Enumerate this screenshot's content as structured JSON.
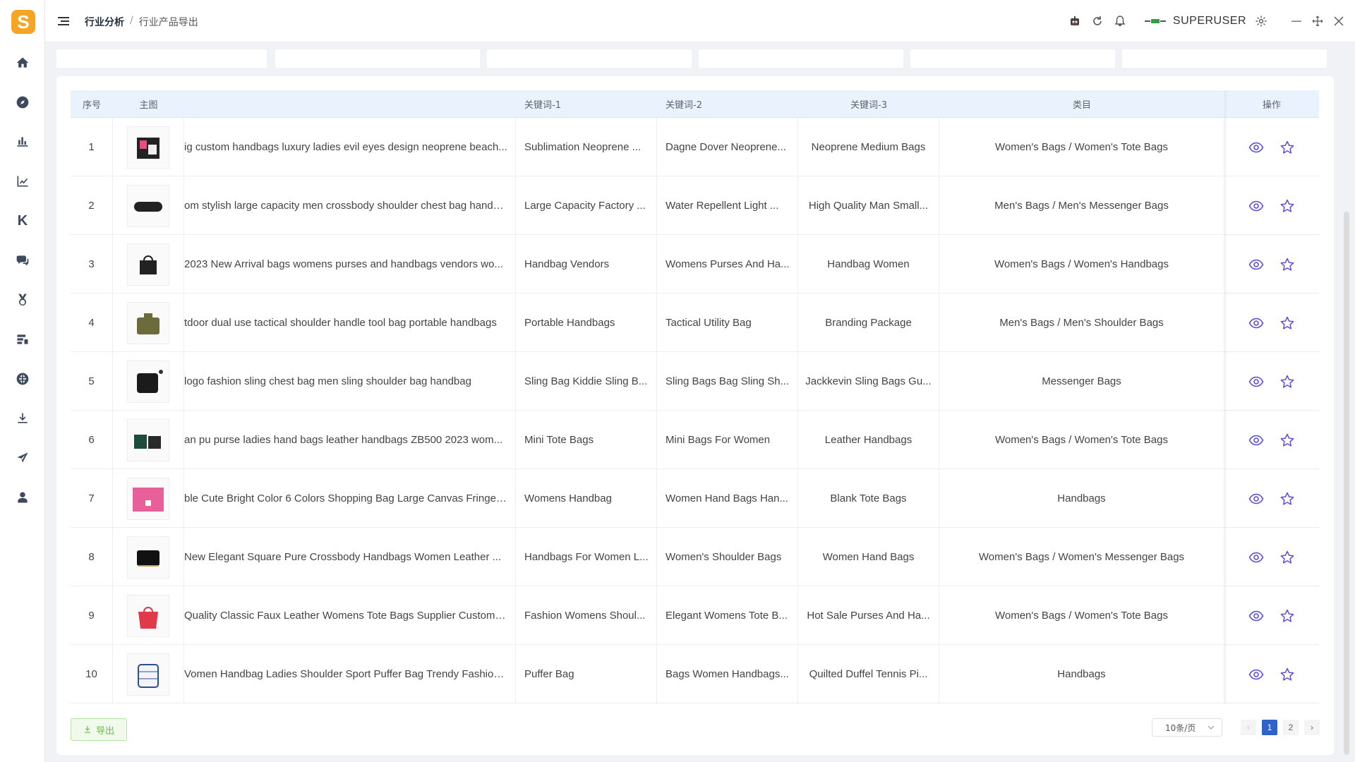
{
  "app": {
    "logo_letter": "S"
  },
  "breadcrumb": {
    "root": "行业分析",
    "separator": "/",
    "current": "行业产品导出"
  },
  "user": {
    "name": "SUPERUSER"
  },
  "sidebar": {
    "icons": [
      "home-icon",
      "compass-icon",
      "analysis-icon",
      "trend-chart-icon",
      "k-icon",
      "chat-icon",
      "medal-icon",
      "product-icon",
      "globe-icon",
      "download-icon",
      "send-icon",
      "user-icon"
    ],
    "k_label": "K"
  },
  "table": {
    "headers": {
      "idx": "序号",
      "img": "主图",
      "title": "",
      "k1": "关键词-1",
      "k2": "关键词-2",
      "k3": "关键词-3",
      "cat": "类目",
      "act": "操作"
    },
    "rows": [
      {
        "idx": "1",
        "title": "ig custom handbags luxury ladies evil eyes design neoprene beach...",
        "k1": "Sublimation Neoprene ...",
        "k2": "Dagne Dover Neoprene...",
        "k3": "Neoprene Medium Bags",
        "cat": "Women's Bags / Women's Tote Bags"
      },
      {
        "idx": "2",
        "title": "om stylish large capacity men crossbody shoulder chest bag handb...",
        "k1": "Large Capacity Factory ...",
        "k2": "Water Repellent Light ...",
        "k3": "High Quality Man Small...",
        "cat": "Men's Bags / Men's Messenger Bags"
      },
      {
        "idx": "3",
        "title": "2023 New Arrival bags womens purses and handbags vendors wo...",
        "k1": "Handbag Vendors",
        "k2": "Womens Purses And Ha...",
        "k3": "Handbag Women",
        "cat": "Women's Bags / Women's Handbags"
      },
      {
        "idx": "4",
        "title": "tdoor dual use tactical shoulder handle tool bag portable handbags",
        "k1": "Portable Handbags",
        "k2": "Tactical Utility Bag",
        "k3": "Branding Package",
        "cat": "Men's Bags / Men's Shoulder Bags"
      },
      {
        "idx": "5",
        "title": "logo fashion sling chest bag men sling shoulder bag handbag",
        "k1": "Sling Bag Kiddie Sling B...",
        "k2": "Sling Bags Bag Sling Sh...",
        "k3": "Jackkevin Sling Bags Gu...",
        "cat": "Messenger Bags"
      },
      {
        "idx": "6",
        "title": "an pu purse ladies hand bags leather handbags ZB500 2023 wom...",
        "k1": "Mini Tote Bags",
        "k2": "Mini Bags For Women",
        "k3": "Leather Handbags",
        "cat": "Women's Bags / Women's Tote Bags"
      },
      {
        "idx": "7",
        "title": "ble Cute Bright Color 6 Colors Shopping Bag Large Canvas Fringe ...",
        "k1": "Womens Handbag",
        "k2": "Women Hand Bags Han...",
        "k3": "Blank Tote Bags",
        "cat": "Handbags"
      },
      {
        "idx": "8",
        "title": "New Elegant Square Pure Crossbody Handbags Women Leather ...",
        "k1": "Handbags For Women L...",
        "k2": "Women's Shoulder Bags",
        "k3": "Women Hand Bags",
        "cat": "Women's Bags / Women's Messenger Bags"
      },
      {
        "idx": "9",
        "title": "Quality Classic Faux Leather Womens Tote Bags Supplier Custom H...",
        "k1": "Fashion Womens Shoul...",
        "k2": "Elegant Womens Tote B...",
        "k3": "Hot Sale Purses And Ha...",
        "cat": "Women's Bags / Women's Tote Bags"
      },
      {
        "idx": "10",
        "title": "Vomen Handbag Ladies Shoulder Sport Puffer Bag Trendy Fashion ...",
        "k1": "Puffer Bag",
        "k2": "Bags Women Handbags...",
        "k3": "Quilted Duffel Tennis Pi...",
        "cat": "Handbags"
      }
    ]
  },
  "footer": {
    "export_label": "导出",
    "page_size": "10条/页",
    "prev": "‹",
    "next": "›",
    "pages": [
      "1",
      "2"
    ],
    "current_page": "1"
  },
  "colors": {
    "accent": "#2e63c8",
    "icon_purple": "#5b4fd8",
    "logo": "#f5a524",
    "header_bg": "#e9f2fd",
    "export_green": "#67c23a"
  }
}
